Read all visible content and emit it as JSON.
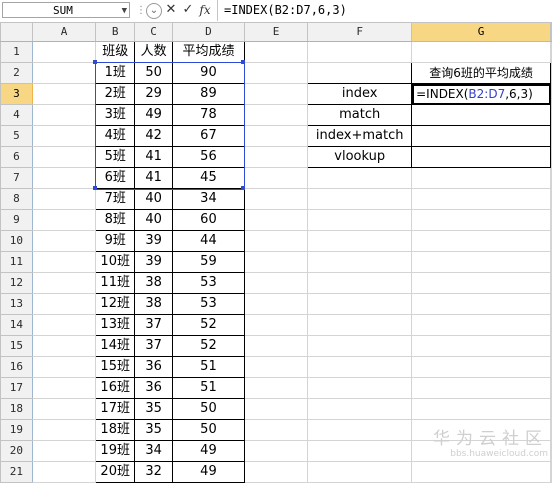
{
  "formula_bar": {
    "name_box": "SUM",
    "formula": "=INDEX(B2:D7,6,3)",
    "cancel_icon": "✕",
    "enter_icon": "✓",
    "fx_label": "fx"
  },
  "columns": [
    "A",
    "B",
    "C",
    "D",
    "E",
    "F",
    "G"
  ],
  "rows": [
    "1",
    "2",
    "3",
    "4",
    "5",
    "6",
    "7",
    "8",
    "9",
    "10",
    "11",
    "12",
    "13",
    "14",
    "15",
    "16",
    "17",
    "18",
    "19",
    "20",
    "21"
  ],
  "table": {
    "headers": [
      "班级",
      "人数",
      "平均成绩"
    ],
    "rows": [
      [
        "1班",
        "50",
        "90"
      ],
      [
        "2班",
        "29",
        "89"
      ],
      [
        "3班",
        "49",
        "78"
      ],
      [
        "4班",
        "42",
        "67"
      ],
      [
        "5班",
        "41",
        "56"
      ],
      [
        "6班",
        "41",
        "45"
      ],
      [
        "7班",
        "40",
        "34"
      ],
      [
        "8班",
        "40",
        "60"
      ],
      [
        "9班",
        "39",
        "44"
      ],
      [
        "10班",
        "39",
        "59"
      ],
      [
        "11班",
        "38",
        "53"
      ],
      [
        "12班",
        "38",
        "53"
      ],
      [
        "13班",
        "37",
        "52"
      ],
      [
        "14班",
        "37",
        "52"
      ],
      [
        "15班",
        "36",
        "51"
      ],
      [
        "16班",
        "36",
        "51"
      ],
      [
        "17班",
        "35",
        "50"
      ],
      [
        "18班",
        "35",
        "50"
      ],
      [
        "19班",
        "34",
        "49"
      ],
      [
        "20班",
        "32",
        "49"
      ]
    ]
  },
  "lookup": {
    "title": "查询6班的平均成绩",
    "labels": [
      "index",
      "match",
      "index+match",
      "vlookup"
    ],
    "editing_formula_prefix": "=INDEX(",
    "editing_formula_ref": "B2:D7",
    "editing_formula_suffix": ",6,3)"
  },
  "watermark": {
    "line1": "华为云社区",
    "line2": "bbs.huaweicloud.com"
  }
}
